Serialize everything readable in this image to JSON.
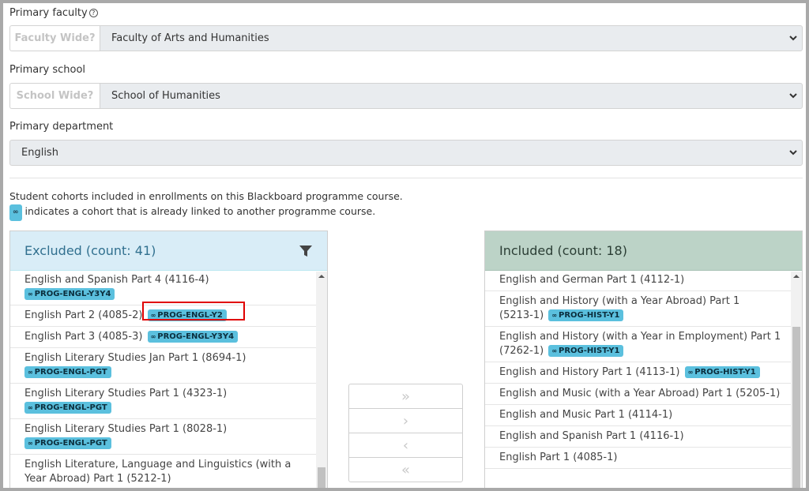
{
  "form": {
    "faculty": {
      "label": "Primary faculty",
      "addon": "Faculty Wide?",
      "value": "Faculty of Arts and Humanities"
    },
    "school": {
      "label": "Primary school",
      "addon": "School Wide?",
      "value": "School of Humanities"
    },
    "department": {
      "label": "Primary department",
      "value": "English"
    }
  },
  "info": {
    "line1": "Student cohorts included in enrollments on this Blackboard programme course.",
    "line2": "indicates a cohort that is already linked to another programme course."
  },
  "excluded": {
    "title": "Excluded (count: 41)",
    "items": [
      {
        "name": "English and Spanish Part 4 (4116-4)",
        "tag": "PROG-ENGL-Y3Y4"
      },
      {
        "name": "English Part 2 (4085-2)",
        "tag": "PROG-ENGL-Y2"
      },
      {
        "name": "English Part 3 (4085-3)",
        "tag": "PROG-ENGL-Y3Y4"
      },
      {
        "name": "English Literary Studies Jan Part 1 (8694-1)",
        "tag": "PROG-ENGL-PGT"
      },
      {
        "name": "English Literary Studies Part 1 (4323-1)",
        "tag": "PROG-ENGL-PGT"
      },
      {
        "name": "English Literary Studies Part 1 (8028-1)",
        "tag": "PROG-ENGL-PGT"
      },
      {
        "name": "English Literature, Language and Linguistics (with a Year Abroad) Part 1 (5212-1)",
        "tag": ""
      }
    ]
  },
  "included": {
    "title": "Included (count: 18)",
    "items": [
      {
        "name": "English and German Part 1 (4112-1)",
        "tag": ""
      },
      {
        "name": "English and History (with a Year Abroad) Part 1 (5213-1)",
        "tag": "PROG-HIST-Y1"
      },
      {
        "name": "English and History (with a Year in Employment) Part 1 (7262-1)",
        "tag": "PROG-HIST-Y1"
      },
      {
        "name": "English and History Part 1 (4113-1)",
        "tag": "PROG-HIST-Y1"
      },
      {
        "name": "English and Music (with a Year Abroad) Part 1 (5205-1)",
        "tag": ""
      },
      {
        "name": "English and Music Part 1 (4114-1)",
        "tag": ""
      },
      {
        "name": "English and Spanish Part 1 (4116-1)",
        "tag": ""
      },
      {
        "name": "English Part 1 (4085-1)",
        "tag": ""
      }
    ]
  },
  "buttons": {
    "include_all": "»",
    "include": "›",
    "exclude": "‹",
    "exclude_all": "«"
  },
  "icons": {
    "link": "link-icon",
    "filter": "filter-icon",
    "help": "help-icon",
    "chevron": "chevron-down-icon"
  },
  "colors": {
    "excluded_header": "#d9edf7",
    "included_header": "#bcd3c7",
    "tag": "#5bc0de",
    "highlight": "#e00000"
  }
}
